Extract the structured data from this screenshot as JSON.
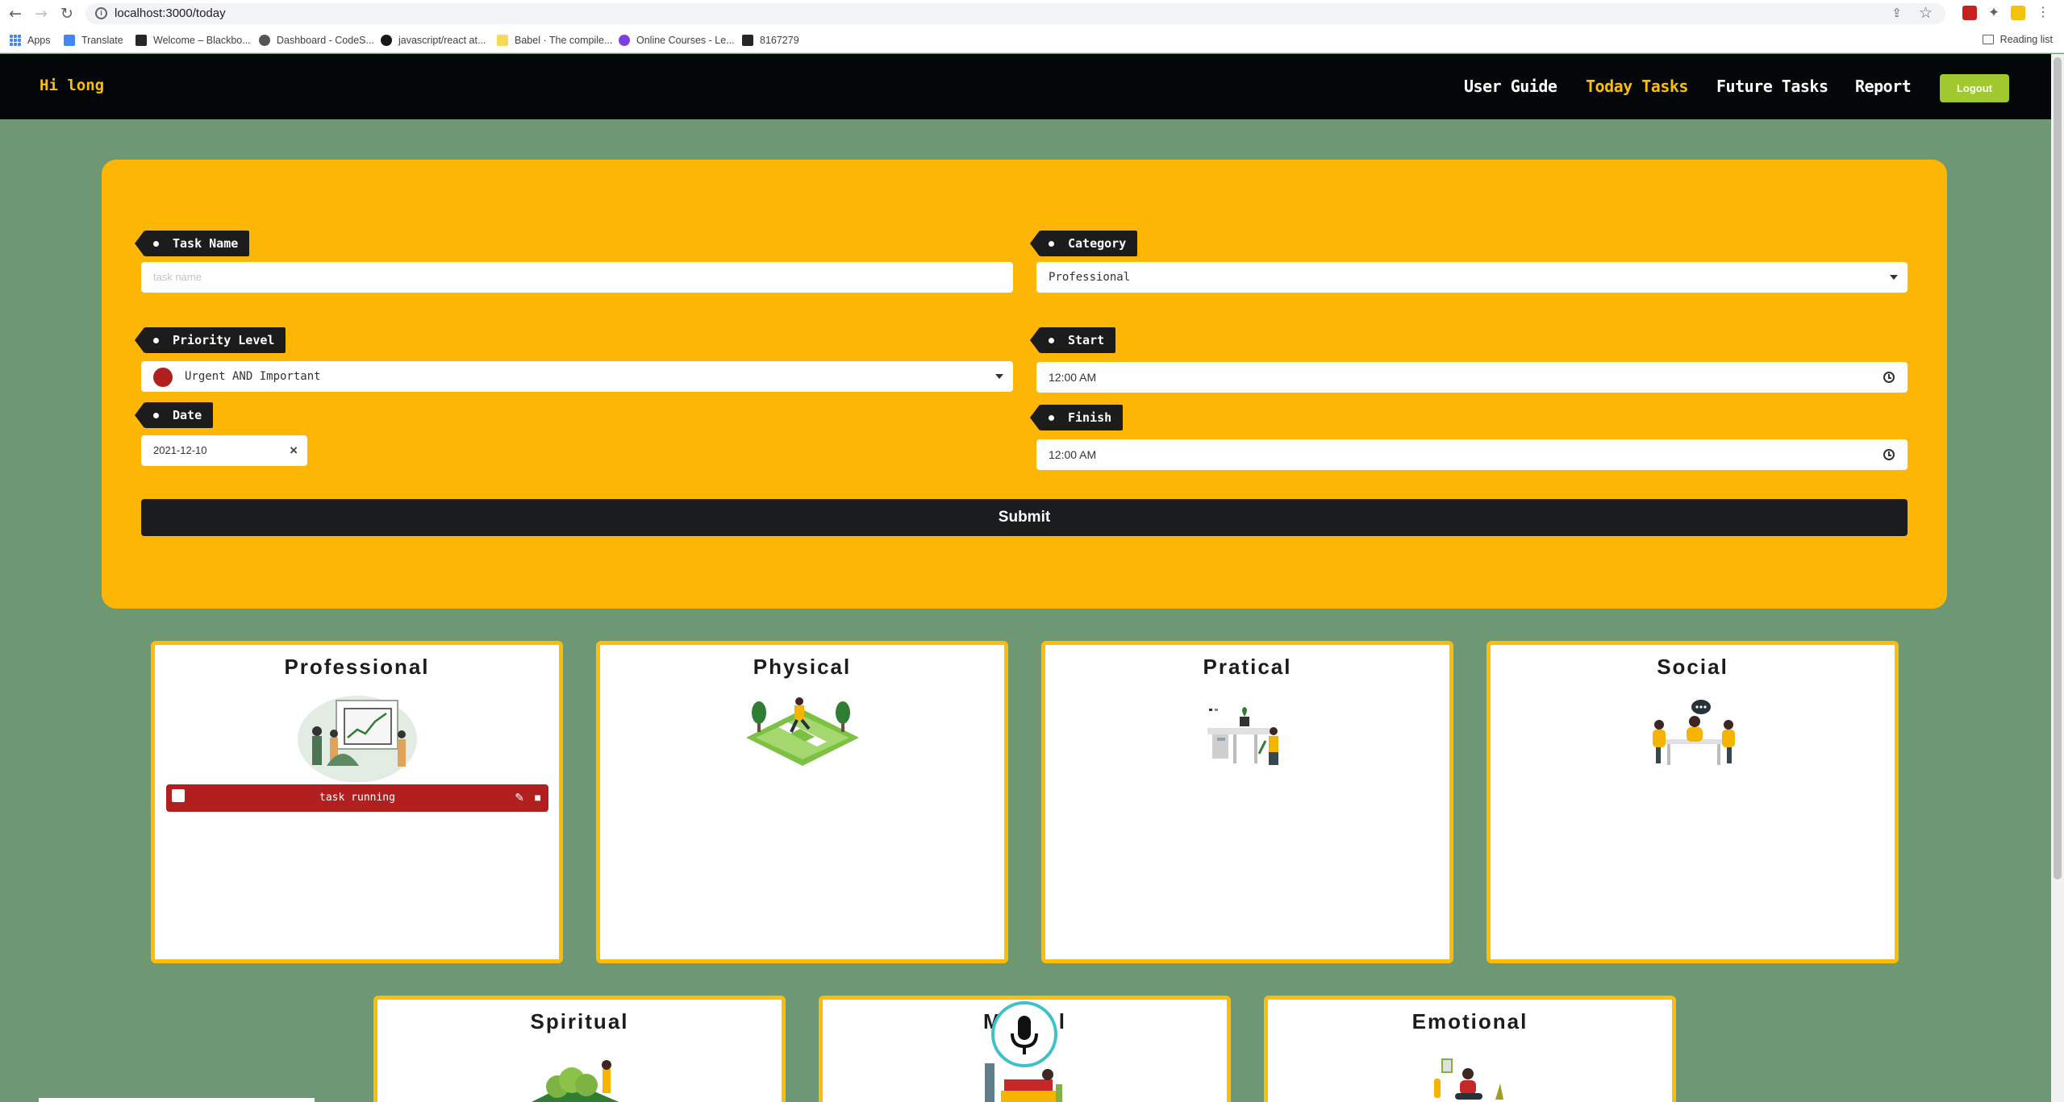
{
  "browser": {
    "url": "localhost:3000/today",
    "bookmarks": [
      {
        "label": "Apps"
      },
      {
        "label": "Translate"
      },
      {
        "label": "Welcome – Blackbo..."
      },
      {
        "label": "Dashboard - CodeS..."
      },
      {
        "label": "javascript/react at..."
      },
      {
        "label": "Babel · The compile..."
      },
      {
        "label": "Online Courses - Le..."
      },
      {
        "label": "8167279"
      }
    ],
    "reading_list": "Reading list"
  },
  "nav": {
    "greeting": "Hi long",
    "links": [
      {
        "label": "User Guide"
      },
      {
        "label": "Today Tasks"
      },
      {
        "label": "Future Tasks"
      },
      {
        "label": "Report"
      }
    ],
    "active_link": "Today Tasks",
    "logout": "Logout"
  },
  "form": {
    "task_name": {
      "label": "Task Name",
      "placeholder": "task name",
      "value": ""
    },
    "category": {
      "label": "Category",
      "value": "Professional"
    },
    "priority": {
      "label": "Priority Level",
      "value": "Urgent AND Important",
      "color": "#b21f1f"
    },
    "start": {
      "label": "Start",
      "value": "12:00 AM"
    },
    "date": {
      "label": "Date",
      "value": "2021-12-10"
    },
    "finish": {
      "label": "Finish",
      "value": "12:00 AM"
    },
    "submit": "Submit"
  },
  "categories": [
    {
      "title": "Professional",
      "icon": "presentation-illustration",
      "tasks": [
        {
          "name": "task running",
          "color": "#b21f1f",
          "done": false
        }
      ]
    },
    {
      "title": "Physical",
      "icon": "running-illustration",
      "tasks": []
    },
    {
      "title": "Pratical",
      "icon": "desk-illustration",
      "tasks": []
    },
    {
      "title": "Social",
      "icon": "meeting-illustration",
      "tasks": []
    },
    {
      "title": "Spiritual",
      "icon": "nature-illustration",
      "tasks": []
    },
    {
      "title": "M",
      "title_end": "l",
      "icon": "reading-illustration",
      "tasks": []
    },
    {
      "title": "Emotional",
      "icon": "meditation-illustration",
      "tasks": []
    }
  ],
  "colors": {
    "page_bg": "#6d9873",
    "nav_bg": "#040707",
    "accent": "#fbbd08",
    "form_bg": "#fdb603",
    "logout_bg": "#a0c92f",
    "task_red": "#b21f1f"
  }
}
